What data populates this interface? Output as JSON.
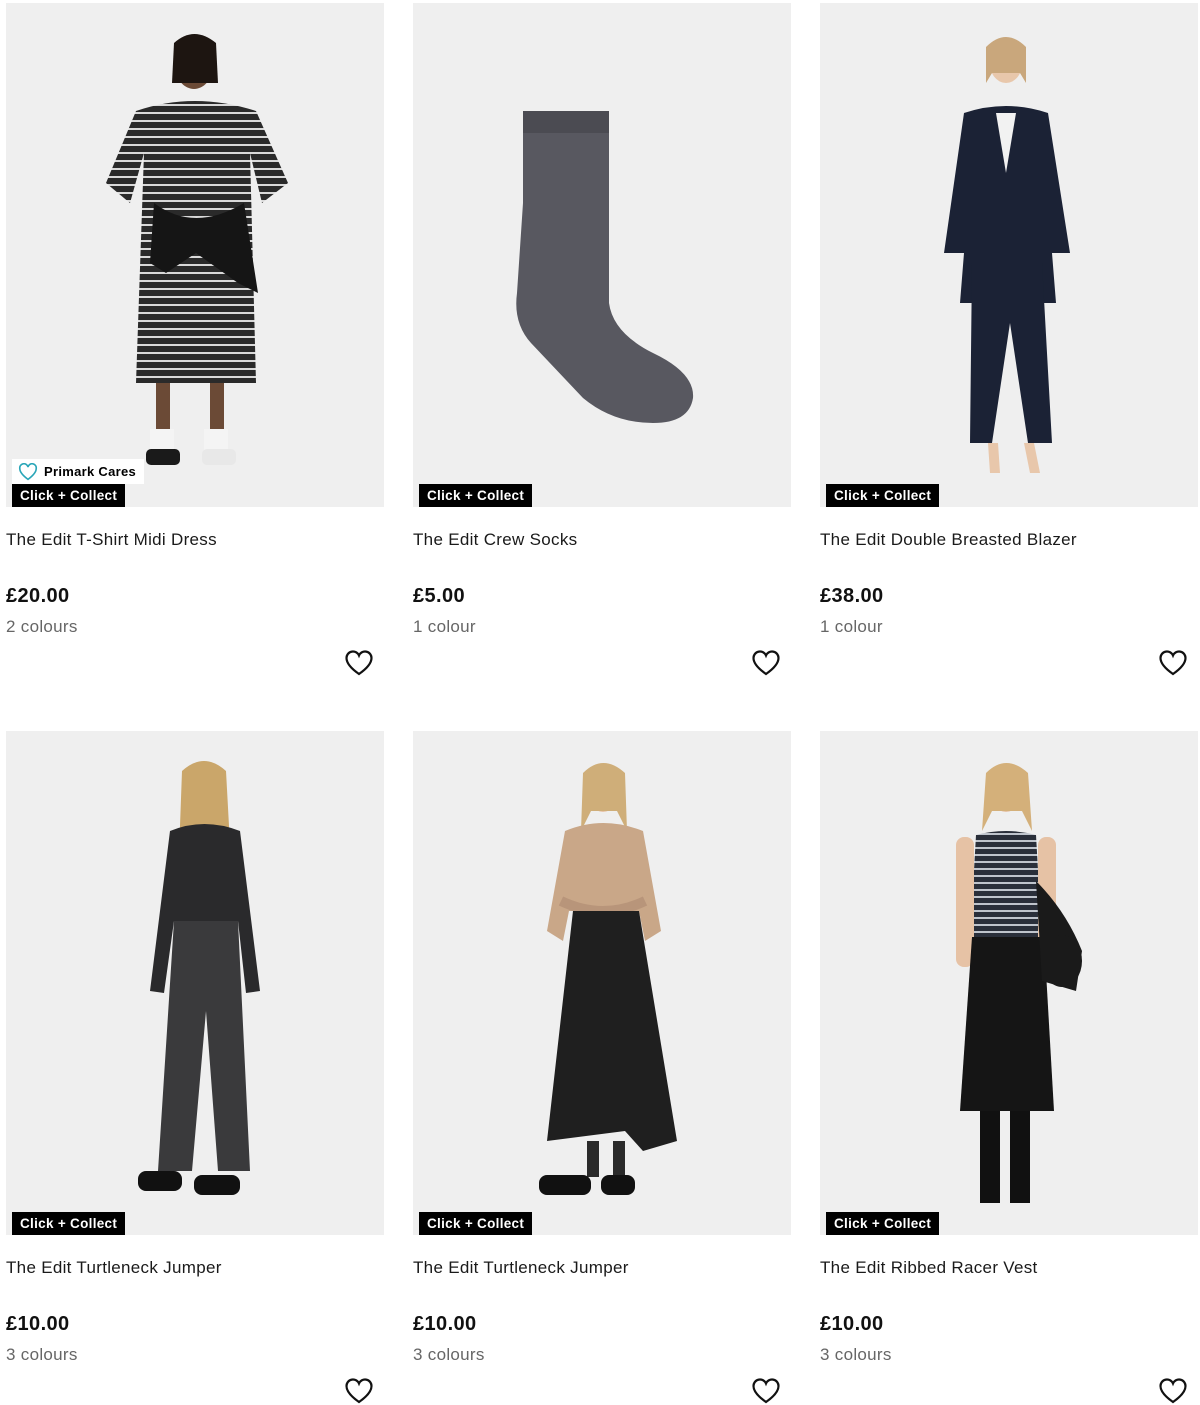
{
  "products": [
    {
      "title": "The Edit T-Shirt Midi Dress",
      "price": "£20.00",
      "colours": "2 colours",
      "badge": "Click + Collect",
      "cares": "Primark Cares",
      "image_icon": "striped-dress-model-image"
    },
    {
      "title": "The Edit Crew Socks",
      "price": "£5.00",
      "colours": "1 colour",
      "badge": "Click + Collect",
      "image_icon": "grey-sock-image"
    },
    {
      "title": "The Edit Double Breasted Blazer",
      "price": "£38.00",
      "colours": "1 colour",
      "badge": "Click + Collect",
      "image_icon": "navy-blazer-model-image"
    },
    {
      "title": "The Edit Turtleneck Jumper",
      "price": "£10.00",
      "colours": "3 colours",
      "badge": "Click + Collect",
      "image_icon": "black-turtleneck-model-image"
    },
    {
      "title": "The Edit Turtleneck Jumper",
      "price": "£10.00",
      "colours": "3 colours",
      "badge": "Click + Collect",
      "image_icon": "beige-turtleneck-model-image"
    },
    {
      "title": "The Edit Ribbed Racer Vest",
      "price": "£10.00",
      "colours": "3 colours",
      "badge": "Click + Collect",
      "image_icon": "striped-vest-model-image"
    }
  ],
  "colors": {
    "badge_bg": "#000000",
    "image_bg": "#efefef",
    "text": "#1a1a1a",
    "muted": "#666666",
    "cares_heart": "#2aa6b8"
  },
  "icons": {
    "wishlist": "heart-outline-icon",
    "cares": "heart-outline-icon"
  }
}
